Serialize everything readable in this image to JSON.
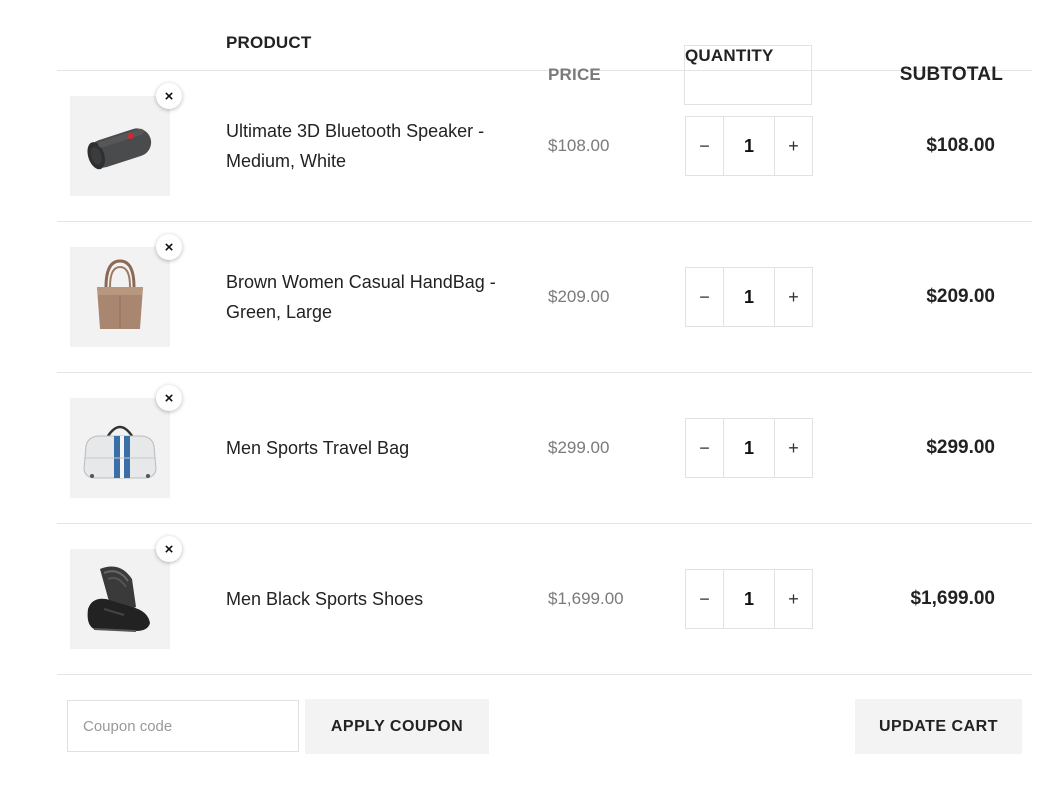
{
  "headers": {
    "product": "PRODUCT",
    "price": "PRICE",
    "quantity": "QUANTITY",
    "subtotal": "SUBTOTAL"
  },
  "items": [
    {
      "name": "Ultimate 3D Bluetooth Speaker - Medium, White",
      "price": "$108.00",
      "quantity": "1",
      "subtotal": "$108.00",
      "image_icon": "speaker-image"
    },
    {
      "name": "Brown Women Casual HandBag - Green, Large",
      "price": "$209.00",
      "quantity": "1",
      "subtotal": "$209.00",
      "image_icon": "handbag-image"
    },
    {
      "name": "Men Sports Travel Bag",
      "price": "$299.00",
      "quantity": "1",
      "subtotal": "$299.00",
      "image_icon": "travel-bag-image"
    },
    {
      "name": "Men Black Sports Shoes",
      "price": "$1,699.00",
      "quantity": "1",
      "subtotal": "$1,699.00",
      "image_icon": "shoes-image"
    }
  ],
  "controls": {
    "remove": "×",
    "minus": "−",
    "plus": "+"
  },
  "coupon": {
    "value": "",
    "placeholder": "Coupon code",
    "apply_label": "APPLY COUPON"
  },
  "update_label": "UPDATE CART"
}
